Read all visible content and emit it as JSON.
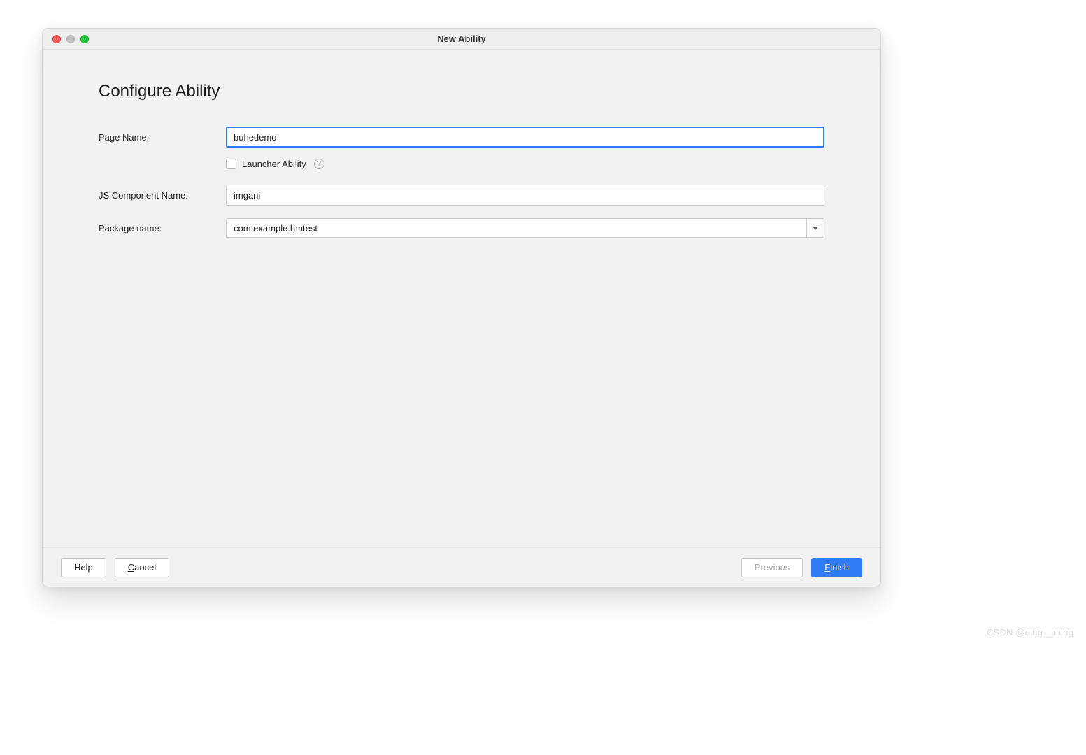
{
  "window": {
    "title": "New Ability"
  },
  "form": {
    "heading": "Configure Ability",
    "page_name_label": "Page Name:",
    "page_name_value": "buhedemo",
    "launcher_ability_label": "Launcher Ability",
    "js_component_name_label": "JS Component Name:",
    "js_component_name_value": "imgani",
    "package_name_label": "Package name:",
    "package_name_value": "com.example.hmtest"
  },
  "buttons": {
    "help": "Help",
    "cancel": "Cancel",
    "previous": "Previous",
    "finish": "Finish"
  },
  "watermark": "CSDN @qing__ming"
}
